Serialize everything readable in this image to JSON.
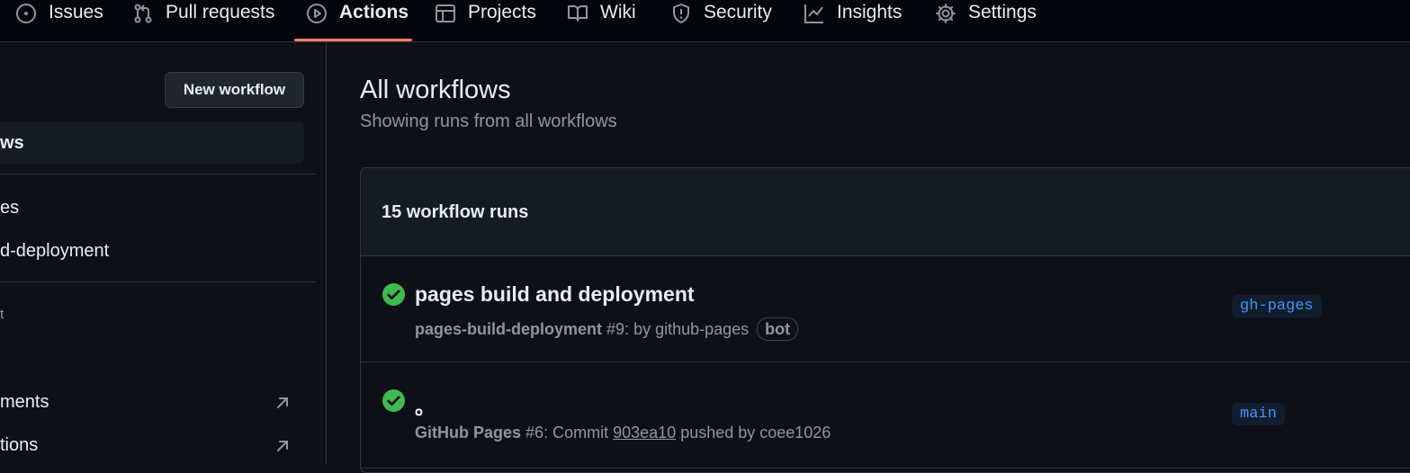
{
  "nav": {
    "tabs": [
      {
        "label": "Issues",
        "icon": "issue-circle-icon"
      },
      {
        "label": "Pull requests",
        "icon": "pull-request-icon"
      },
      {
        "label": "Actions",
        "icon": "play-circle-icon",
        "active": true
      },
      {
        "label": "Projects",
        "icon": "table-icon"
      },
      {
        "label": "Wiki",
        "icon": "book-icon"
      },
      {
        "label": "Security",
        "icon": "shield-icon"
      },
      {
        "label": "Insights",
        "icon": "graph-icon"
      },
      {
        "label": "Settings",
        "icon": "gear-icon"
      }
    ],
    "accent_color": "#f78166"
  },
  "sidebar": {
    "new_workflow_label": "New workflow",
    "items": [
      {
        "label": "ws"
      },
      {
        "label": "es"
      },
      {
        "label": "d-deployment"
      },
      {
        "label": "t"
      },
      {
        "label": "ments",
        "icon": "arrow-up-right-icon"
      },
      {
        "label": "tions",
        "icon": "arrow-up-right-icon"
      }
    ]
  },
  "main": {
    "title": "All workflows",
    "subtitle": "Showing runs from all workflows",
    "runs_count": "15 workflow runs",
    "runs": [
      {
        "status": "success",
        "title": "pages build and deployment",
        "workflow": "pages-build-deployment",
        "number": "#9",
        "meta_text": ": by github-pages",
        "badge": "bot",
        "branch": "gh-pages"
      },
      {
        "status": "success",
        "title": "。",
        "workflow": "GitHub Pages",
        "number": "#6",
        "meta_prefix": ": Commit",
        "sha": "903ea10",
        "meta_suffix": "pushed by coee1026",
        "branch": "main"
      }
    ],
    "success_color": "#3fb950",
    "branch_color": "#4493f8"
  }
}
